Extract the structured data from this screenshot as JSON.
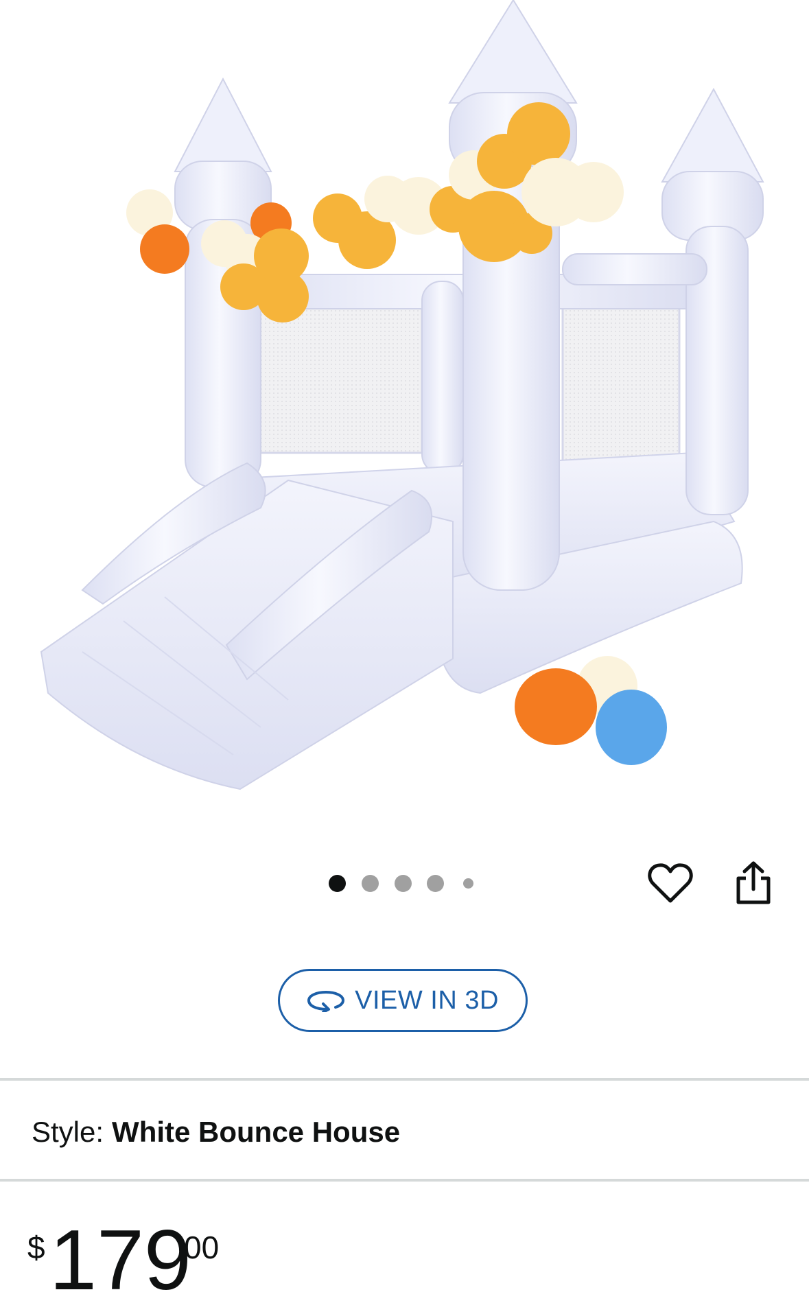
{
  "product": {
    "image_alt": "White inflatable bounce house with slide and balloons"
  },
  "carousel": {
    "total": 5,
    "active": 1
  },
  "actions": {
    "wishlist_icon": "heart-icon",
    "share_icon": "share-icon"
  },
  "view3d": {
    "label": "VIEW IN 3D",
    "icon": "rotate-3d-icon"
  },
  "style": {
    "label": "Style:",
    "value": "White Bounce House"
  },
  "price": {
    "symbol": "$",
    "whole": "179",
    "fraction": "00"
  },
  "colors": {
    "accent": "#1c5fa8",
    "text": "#0f1111",
    "divider": "#d5d9d9",
    "balloon_yellow": "#f6b43a",
    "balloon_orange": "#f47b20",
    "balloon_cream": "#fbf3dd",
    "balloon_blue": "#5aa6ea"
  }
}
